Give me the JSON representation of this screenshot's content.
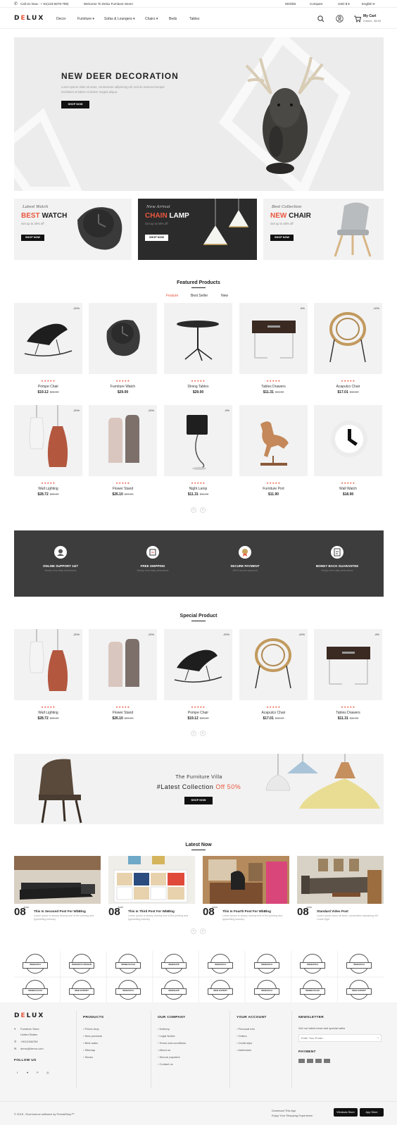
{
  "topbar": {
    "phone": "Call Us Now : + 91(123-5678-789)",
    "welcome": "Welcome To Delux Furniture Store!",
    "wishlist": "Wishlist",
    "compare": "Compare",
    "currency": "USD $",
    "language": "English"
  },
  "header": {
    "logo": "DELUX",
    "nav": [
      "Decor",
      "Furniture",
      "Sofas & Loungers",
      "Chairs",
      "Beds",
      "Tables"
    ],
    "cart_title": "My Cart",
    "cart_info": "0 items - $0.00"
  },
  "hero": {
    "title": "NEW DEER DECORATION",
    "text1": "Lorem ipsum dolor sit amet, consectetur adipiscing elit, sed do eiusmod tempor",
    "text2": "incididunt ut labore et dolore magna aliqua.",
    "button": "SHOP NOW"
  },
  "promos": [
    {
      "script": "Latest Watch",
      "accent": "BEST",
      "word": "WATCH",
      "sub": "Get up to 30% off",
      "button": "SHOP NOW"
    },
    {
      "script": "New Arrival",
      "accent": "CHAIN",
      "word": "LAMP",
      "sub": "Get up to 50% off",
      "button": "SHOP NOW"
    },
    {
      "script": "Best Collection",
      "accent": "NEW",
      "word": "CHAIR",
      "sub": "Get up to 45% off",
      "button": "SHOP NOW"
    }
  ],
  "featured": {
    "title": "Featured Products",
    "tabs": [
      "Feature",
      "Best Seller",
      "New"
    ],
    "products": [
      {
        "name": "Pompe Chair",
        "price": "$19.12",
        "old": "$23.90",
        "badge": "-20%",
        "stars": "★★★★★"
      },
      {
        "name": "Furniture Watch",
        "price": "$29.00",
        "old": "",
        "badge": "",
        "stars": "★★★★★"
      },
      {
        "name": "Dining Tables",
        "price": "$29.00",
        "old": "",
        "badge": "",
        "stars": "★★★★★"
      },
      {
        "name": "Tables Drawers",
        "price": "$11.31",
        "old": "$11.90",
        "badge": "-5%",
        "stars": "★★★★★"
      },
      {
        "name": "Acapulco Chair",
        "price": "$17.01",
        "old": "$18.90",
        "badge": "-10%",
        "stars": "★★★★★"
      },
      {
        "name": "Wall Lighting",
        "price": "$28.72",
        "old": "$35.90",
        "badge": "-20%",
        "stars": "★★★★★"
      },
      {
        "name": "Flower Stand",
        "price": "$26.10",
        "old": "$29.00",
        "badge": "-10%",
        "stars": "★★★★★"
      },
      {
        "name": "Night Lamp",
        "price": "$11.31",
        "old": "$11.90",
        "badge": "-5%",
        "stars": "★★★★★"
      },
      {
        "name": "Furniture Port",
        "price": "$11.90",
        "old": "",
        "badge": "",
        "stars": "★★★★★"
      },
      {
        "name": "Wall Watch",
        "price": "$18.90",
        "old": "",
        "badge": "",
        "stars": "★★★★★"
      }
    ]
  },
  "services": [
    {
      "title": "ONLINE SUPPORT 24/7",
      "desc": "Nearly time daily deductions"
    },
    {
      "title": "FREE SHIPPING",
      "desc": "Nearly time daily deductions"
    },
    {
      "title": "SECURE PAYMENT",
      "desc": "100% secure payment"
    },
    {
      "title": "MONEY BACK GUARANTEE",
      "desc": "Nearly time daily deductions"
    }
  ],
  "special": {
    "title": "Special Product",
    "products": [
      {
        "name": "Wall Lighting",
        "price": "$28.72",
        "old": "$35.90",
        "badge": "-20%",
        "stars": "★★★★★"
      },
      {
        "name": "Flower Stand",
        "price": "$26.10",
        "old": "$29.00",
        "badge": "-10%",
        "stars": "★★★★★"
      },
      {
        "name": "Pompe Chair",
        "price": "$19.12",
        "old": "$23.90",
        "badge": "-20%",
        "stars": "★★★★★"
      },
      {
        "name": "Acapulco Chair",
        "price": "$17.01",
        "old": "$18.90",
        "badge": "-10%",
        "stars": "★★★★★"
      },
      {
        "name": "Tables Drawers",
        "price": "$11.31",
        "old": "$11.90",
        "badge": "-5%",
        "stars": "★★★★★"
      }
    ]
  },
  "banner": {
    "subtitle": "The Furniture Villa",
    "title": "#Latest Collection",
    "accent": "Off 50%",
    "button": "SHOP NOW"
  },
  "blog": {
    "title": "Latest Now",
    "posts": [
      {
        "day": "08",
        "month": "June",
        "title": "This Is Secound Post For WbBlog",
        "text": "Lorem Ipsum is simply dummy text of the printing and typesetting industry."
      },
      {
        "day": "08",
        "month": "June",
        "title": "This Is Third Post For WbBlog",
        "text": "Lorem Ipsum is simply dummy text of the printing and typesetting industry."
      },
      {
        "day": "08",
        "month": "June",
        "title": "This Is Fourth Post For WbBlog",
        "text": "Lorem Ipsum is simply dummy text of the printing and typesetting industry."
      },
      {
        "day": "08",
        "month": "June",
        "title": "Standard Video Post",
        "text": "Lorem Ipsum dolor sit amet, consectetur adipiscing elit. Curde Eget."
      }
    ]
  },
  "brands": [
    "WEBARCH",
    "WEBARCH DESIGN",
    "WEBBAZAAR",
    "WEBSHOP",
    "WEBARCH",
    "WEBARCH",
    "WEBARCH",
    "WEBARCH",
    "WEBBAZAAR",
    "WEB EXPERT",
    "WEBARCH",
    "WEBSHOP",
    "WEB EXPERT",
    "WEBARCH",
    "WEBBAZAAR",
    "WEB EXPERT"
  ],
  "footer": {
    "logo": "DELUX",
    "store": [
      "Furniture Store",
      "United States",
      "+9012456789",
      "demo@demo.com"
    ],
    "follow": "FOLLOW US",
    "products_title": "PRODUCTS",
    "products": [
      "Prices drop",
      "New products",
      "Best sales",
      "Sitemap",
      "Stores"
    ],
    "company_title": "OUR COMPANY",
    "company": [
      "Delivery",
      "Legal Notice",
      "Terms and conditions",
      "About us",
      "Secure payment",
      "Contact us"
    ],
    "account_title": "YOUR ACCOUNT",
    "account": [
      "Personal info",
      "Orders",
      "Credit slips",
      "Addresses"
    ],
    "newsletter_title": "NEWSLETTER",
    "newsletter_text": "Get our latest news and special sales",
    "email_placeholder": "Enter Your Email...",
    "payment_title": "PAYMENT",
    "copyright": "© 2018 - Ecommerce software by PrestaShop™",
    "app1": "Download This App",
    "app2": "Enjoy Your Shopping Experience",
    "store1": "Windows Store",
    "store2": "App Store"
  },
  "colors": {
    "accent": "#e9573f",
    "dark": "#3d3d3d",
    "light": "#f2f2f2"
  }
}
